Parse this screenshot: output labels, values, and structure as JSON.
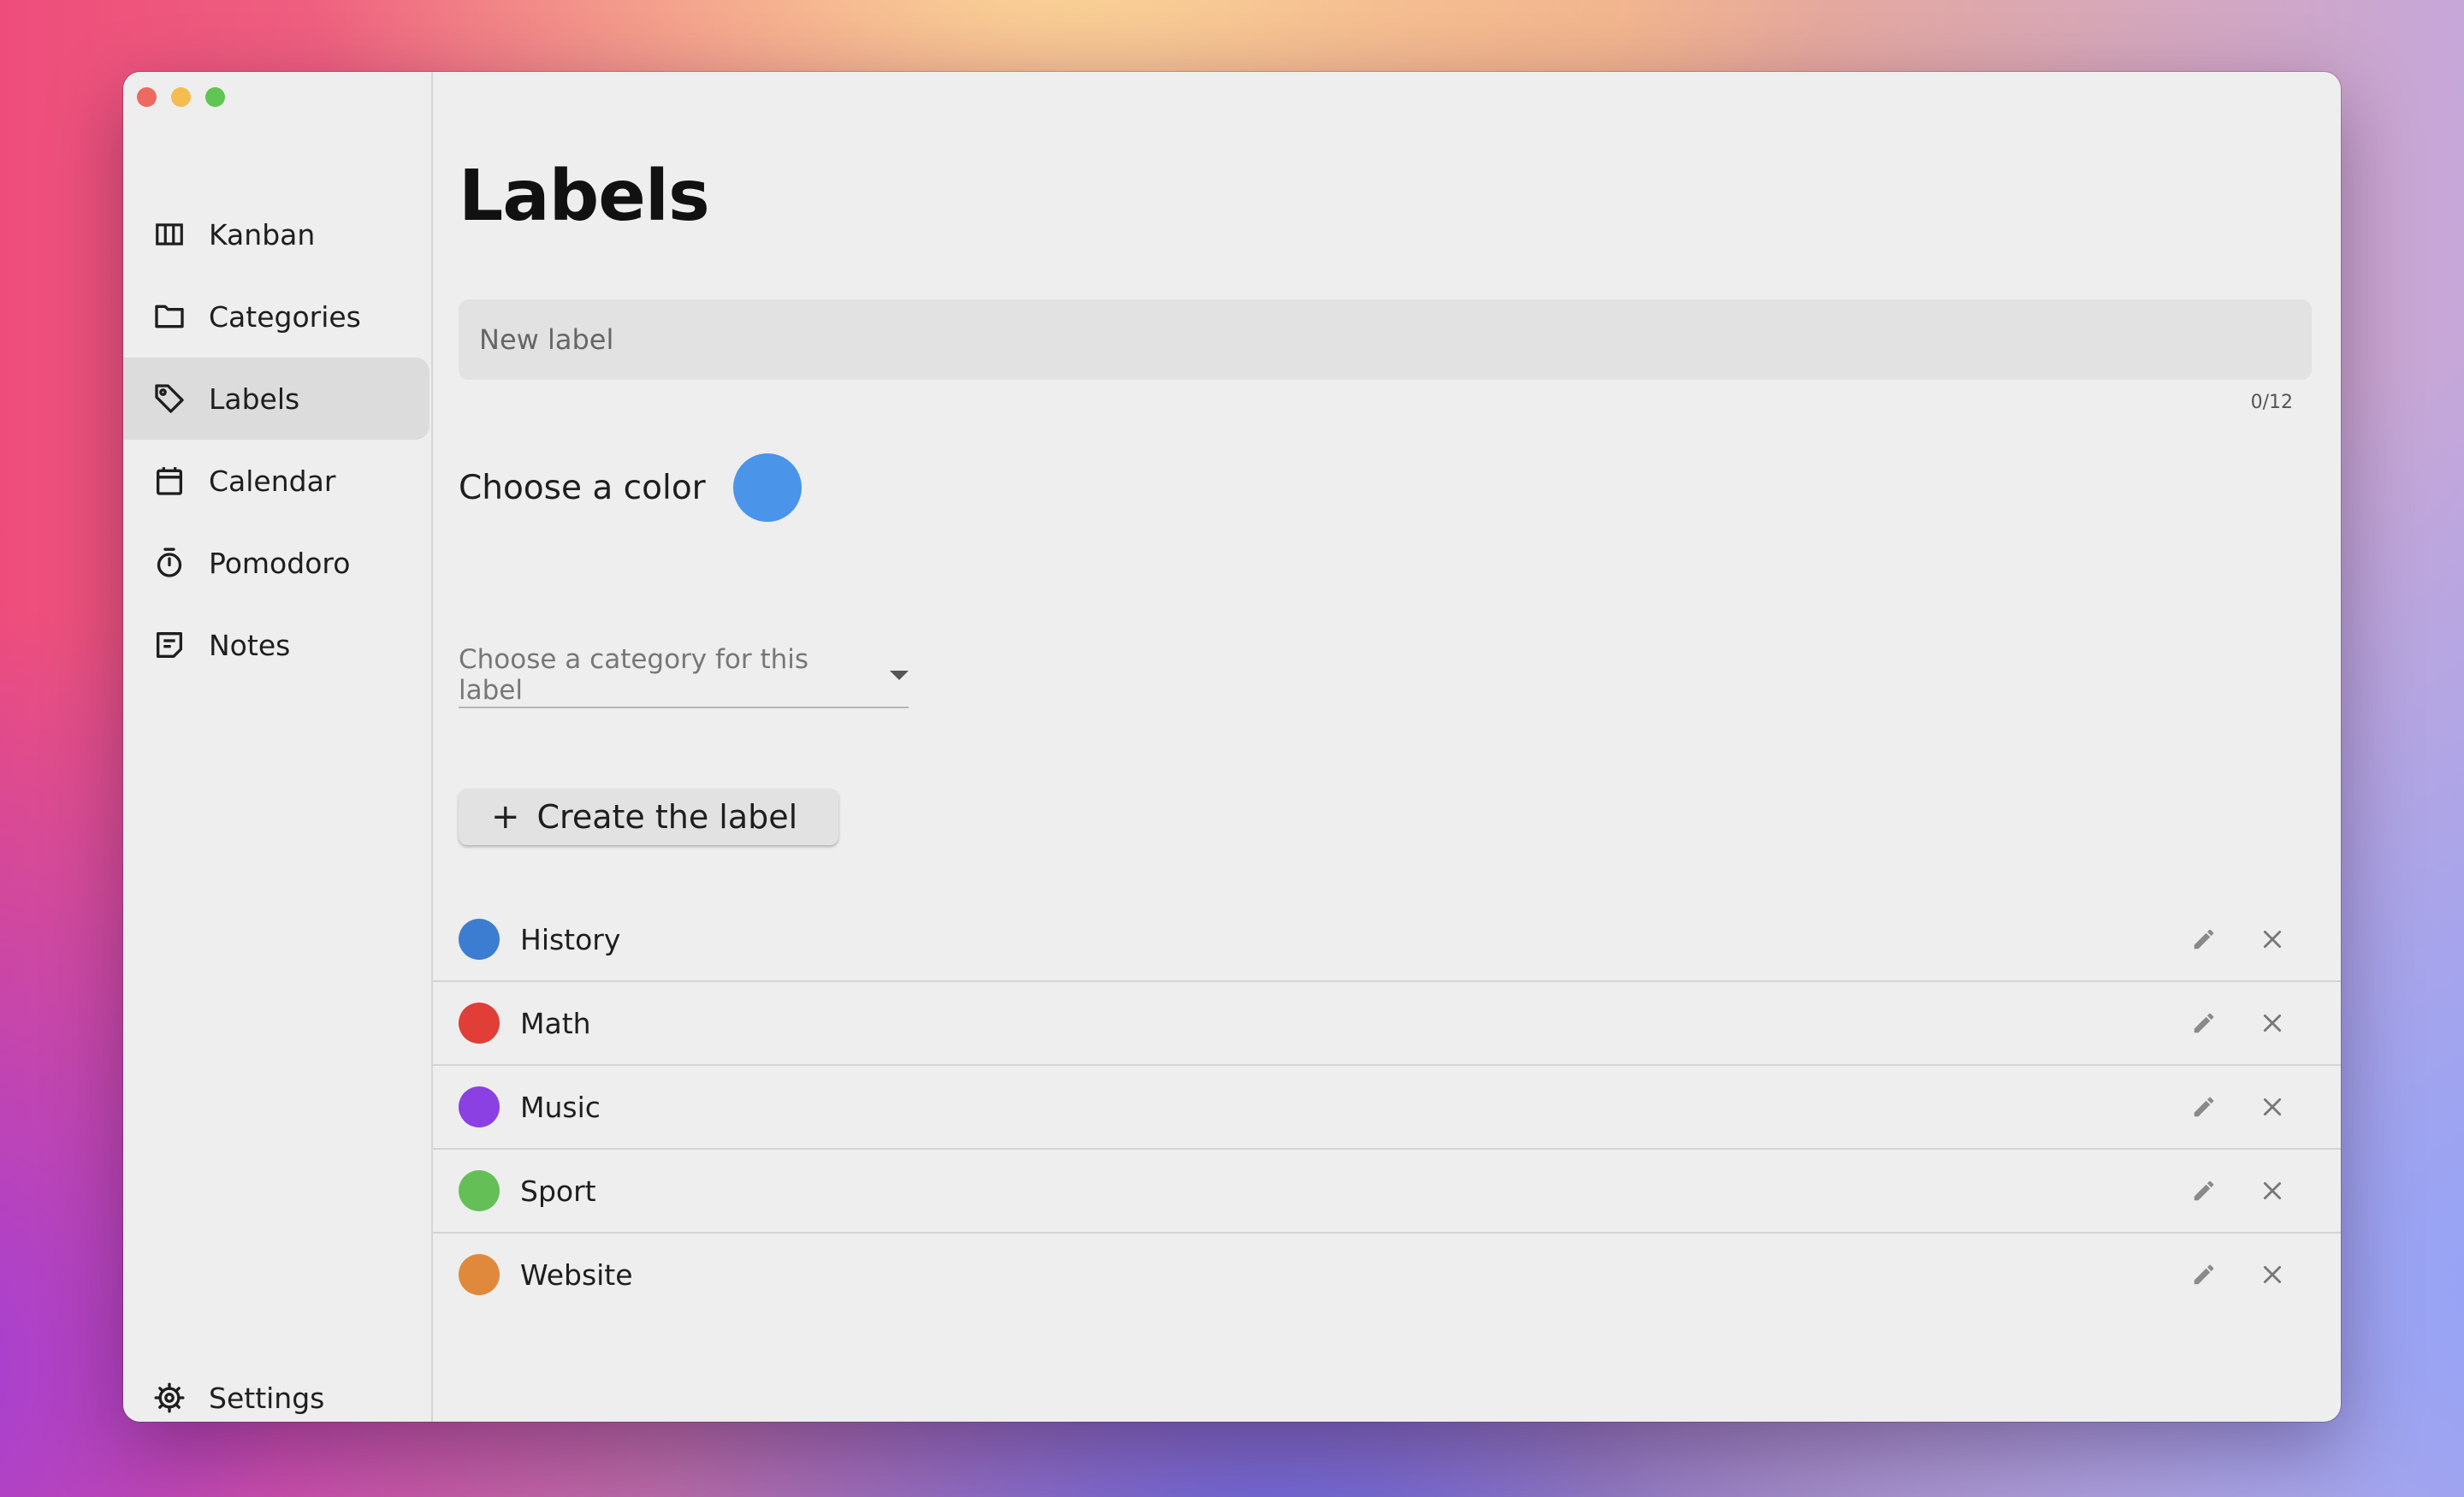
{
  "sidebar": {
    "items": [
      {
        "label": "Kanban",
        "icon": "kanban-icon"
      },
      {
        "label": "Categories",
        "icon": "folder-icon"
      },
      {
        "label": "Labels",
        "icon": "tag-icon",
        "active": true
      },
      {
        "label": "Calendar",
        "icon": "calendar-icon"
      },
      {
        "label": "Pomodoro",
        "icon": "timer-icon"
      },
      {
        "label": "Notes",
        "icon": "notes-icon"
      }
    ],
    "settings_label": "Settings"
  },
  "main": {
    "title": "Labels",
    "new_label": {
      "placeholder": "New label",
      "value": "",
      "counter": "0/12"
    },
    "color_prompt": "Choose a color",
    "selected_color": "#4a94ea",
    "category_select": {
      "placeholder": "Choose a category for this label"
    },
    "create_button": {
      "icon": "plus-icon",
      "label": "Create the label"
    },
    "labels": [
      {
        "name": "History",
        "color": "#3d7dd1"
      },
      {
        "name": "Math",
        "color": "#e03e36"
      },
      {
        "name": "Music",
        "color": "#8a40e3"
      },
      {
        "name": "Sport",
        "color": "#64bf57"
      },
      {
        "name": "Website",
        "color": "#e0893d"
      }
    ]
  }
}
